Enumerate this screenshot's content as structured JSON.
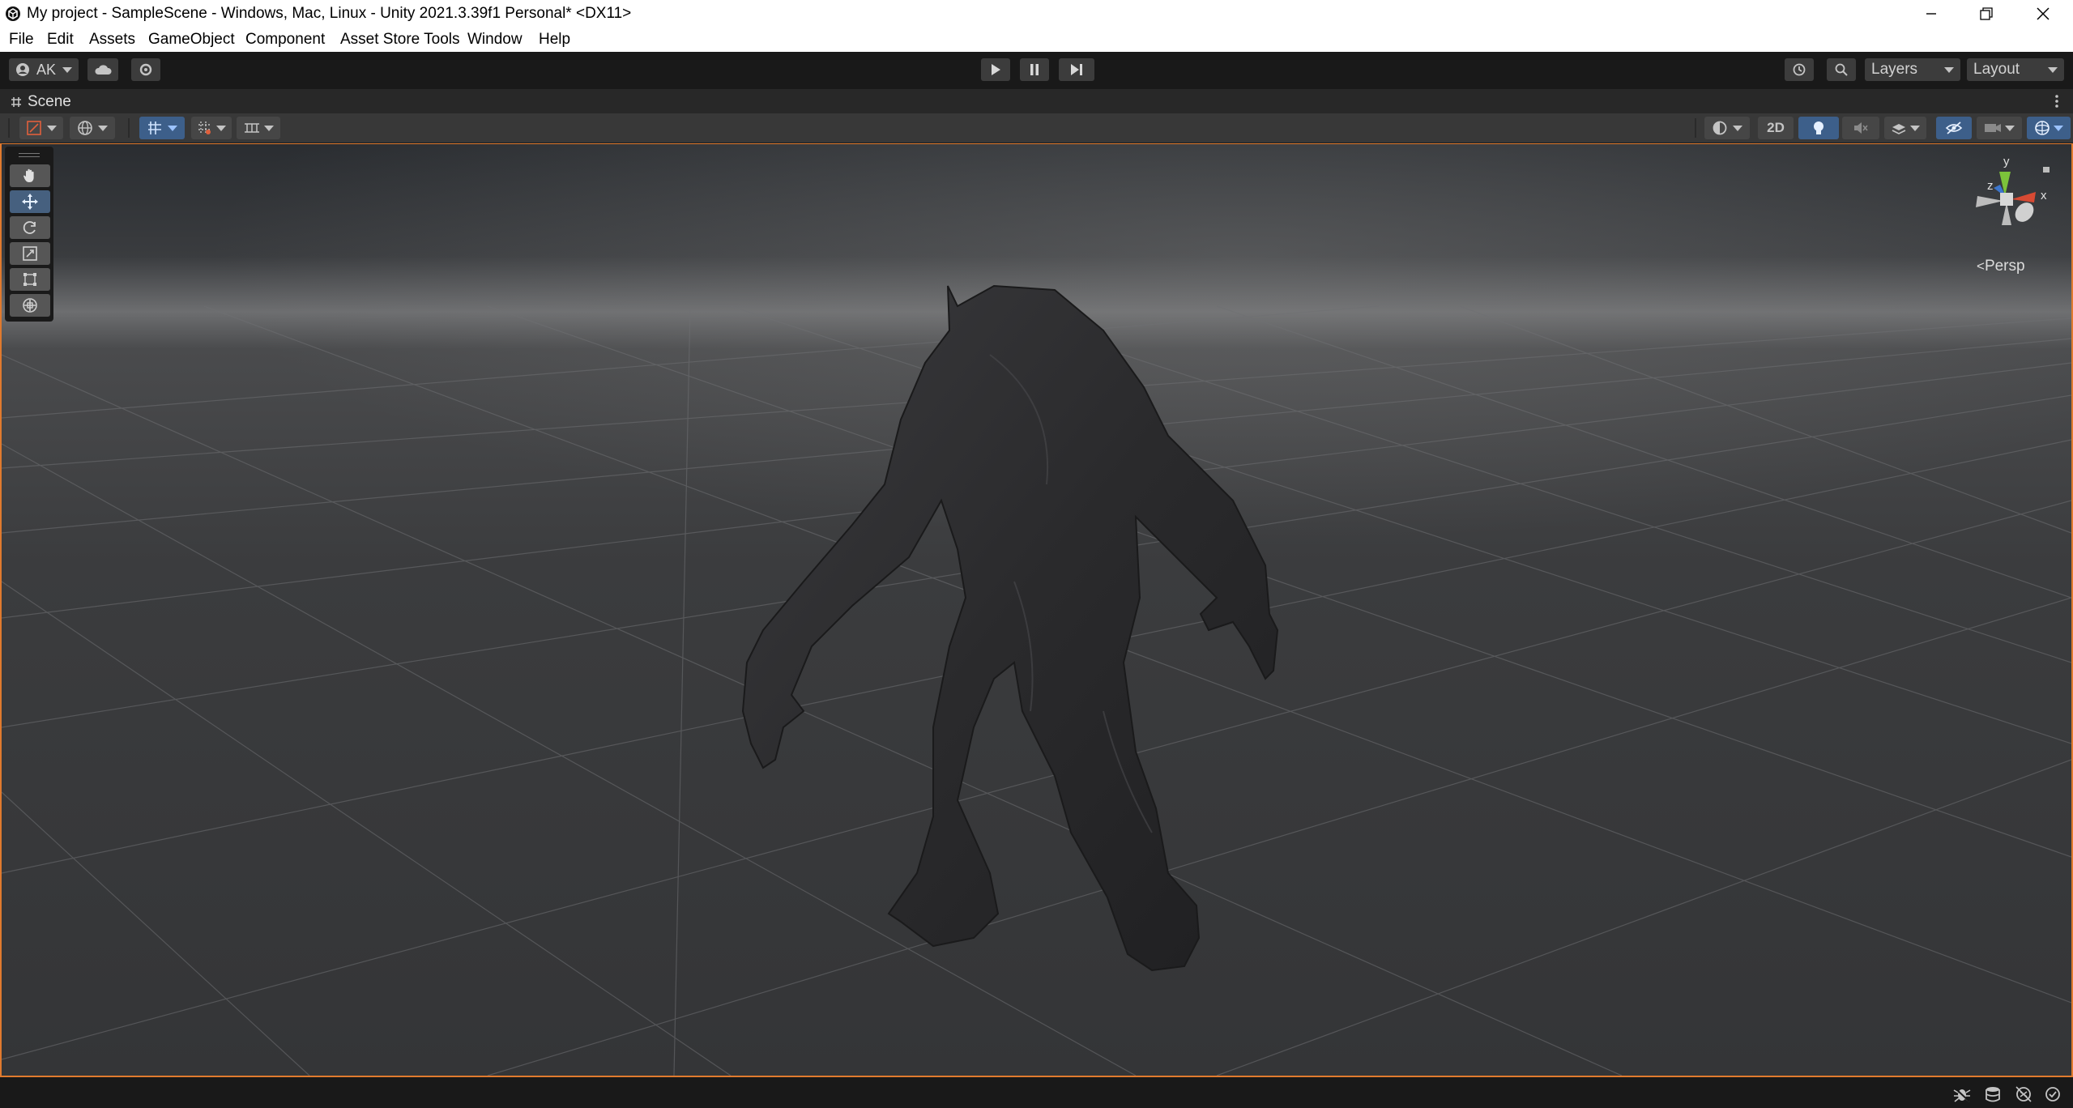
{
  "window": {
    "title": "My project - SampleScene - Windows, Mac, Linux - Unity 2021.3.39f1 Personal* <DX11>",
    "controls": [
      "minimize-icon",
      "restore-icon",
      "close-icon"
    ]
  },
  "menu": {
    "items": [
      "File",
      "Edit",
      "Assets",
      "GameObject",
      "Component",
      "Asset Store Tools",
      "Window",
      "Help"
    ]
  },
  "toolbar": {
    "account_label": "AK",
    "layers_label": "Layers",
    "layout_label": "Layout",
    "play_icon": "play-icon",
    "pause_icon": "pause-icon",
    "step_icon": "step-icon"
  },
  "scene_tab": {
    "label": "Scene"
  },
  "scene_toolbar": {
    "mode_2d_label": "2D"
  },
  "tools": [
    "hand-tool-icon",
    "move-tool-icon",
    "rotate-tool-icon",
    "scale-tool-icon",
    "rect-tool-icon",
    "transform-tool-icon"
  ],
  "active_tool": "move-tool-icon",
  "gizmo": {
    "y": "y",
    "x": "x",
    "z": "z",
    "projection_label": "Persp"
  },
  "colors": {
    "accent_orange": "#e07a2e",
    "active_blue": "#46607f",
    "axis_x": "#d84a33",
    "axis_y": "#7cc33a",
    "axis_z": "#3d76cc"
  }
}
